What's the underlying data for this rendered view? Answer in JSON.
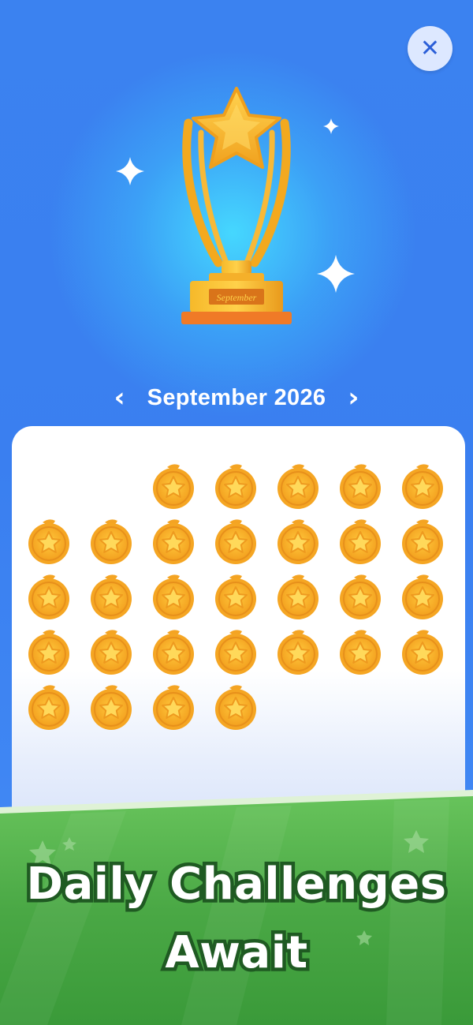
{
  "header": {
    "close_icon": "close-icon",
    "trophy_plaque": "September"
  },
  "calendar": {
    "month_label": "September 2026",
    "prev_icon": "chevron-left-icon",
    "next_icon": "chevron-right-icon",
    "leading_blank_days": 2,
    "days_in_month": 30,
    "medals_earned": 30,
    "medal_icon": "star-medal-icon"
  },
  "banner": {
    "line1": "Daily Challenges",
    "line2": "Await"
  },
  "colors": {
    "background_blue": "#3b82f0",
    "medal_gold": "#f7a928",
    "banner_green": "#3f9e3c",
    "headline_outline": "#1f5a22"
  }
}
